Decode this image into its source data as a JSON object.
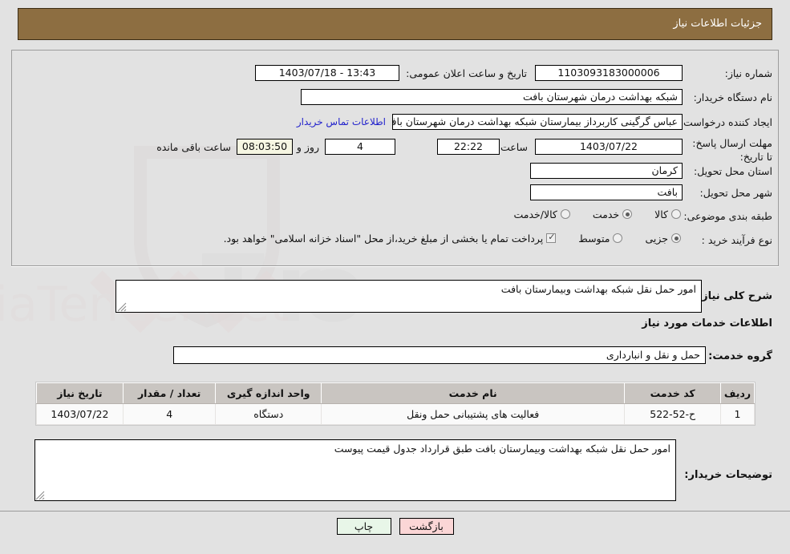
{
  "header": {
    "title": "جزئیات اطلاعات نیاز"
  },
  "form": {
    "need_number_label": "شماره نیاز:",
    "need_number_value": "1103093183000006",
    "announce_label": "تاریخ و ساعت اعلان عمومی:",
    "announce_value": "13:43 - 1403/07/18",
    "buyer_org_label": "نام دستگاه خریدار:",
    "buyer_org_value": "شبکه بهداشت درمان شهرستان بافت",
    "requester_label": "ایجاد کننده درخواست:",
    "requester_value": "عباس  گرگینی کاربرداز بیمارستان شبکه بهداشت درمان شهرستان بافت",
    "contact_link": "اطلاعات تماس خریدار",
    "deadline_label": "مهلت ارسال پاسخ: تا تاریخ:",
    "deadline_date": "1403/07/22",
    "hour_label": "ساعت",
    "deadline_time": "22:22",
    "days_remaining": "4",
    "days_label": "روز و",
    "countdown": "08:03:50",
    "countdown_label": "ساعت باقی مانده",
    "province_label": "استان محل تحویل:",
    "province_value": "کرمان",
    "city_label": "شهر محل تحویل:",
    "city_value": "بافت",
    "category_label": "طبقه بندی موضوعی:",
    "category_options": [
      {
        "label": "کالا",
        "selected": false
      },
      {
        "label": "خدمت",
        "selected": true
      },
      {
        "label": "کالا/خدمت",
        "selected": false
      }
    ],
    "process_label": "نوع فرآیند خرید :",
    "process_options": [
      {
        "label": "جزیی",
        "selected": true
      },
      {
        "label": "متوسط",
        "selected": false
      }
    ],
    "treasury_checked": true,
    "treasury_note": "پرداخت تمام یا بخشی از مبلغ خرید،از محل \"اسناد خزانه اسلامی\" خواهد بود."
  },
  "need_summary": {
    "label": "شرح کلی نیاز:",
    "value": "امور حمل نقل شبکه بهداشت وبیمارستان بافت"
  },
  "services_section": {
    "heading": "اطلاعات خدمات مورد نیاز",
    "group_label": "گروه خدمت:",
    "group_value": "حمل و نقل و انبارداری"
  },
  "table": {
    "columns": [
      "ردیف",
      "کد خدمت",
      "نام خدمت",
      "واحد اندازه گیری",
      "تعداد / مقدار",
      "تاریخ نیاز"
    ],
    "rows": [
      [
        "1",
        "ح-52-522",
        "فعالیت های پشتیبانی حمل ونقل",
        "دستگاه",
        "4",
        "1403/07/22"
      ]
    ]
  },
  "buyer_notes": {
    "label": "توضیحات خریدار:",
    "value": "امور حمل نقل شبکه بهداشت وبیمارستان بافت طبق قرارداد جدول قیمت پیوست"
  },
  "footer": {
    "print_label": "چاپ",
    "back_label": "بازگشت"
  },
  "colors": {
    "header_brown": "#8d6e41",
    "page_bg": "#e2e2e2",
    "link_blue": "#2222cc",
    "print_green": "#e8f6e8",
    "back_pink": "#fbd6d6",
    "countdown_cream": "#f6f6e2"
  }
}
